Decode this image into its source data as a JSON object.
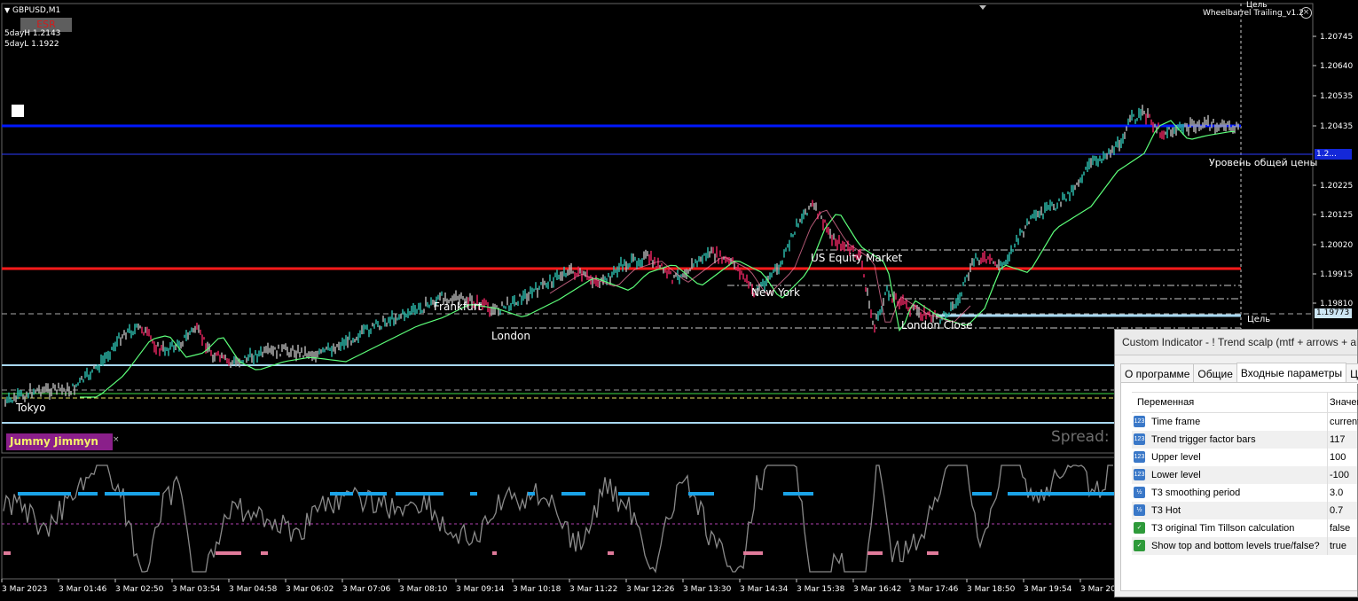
{
  "chart": {
    "symbol": "GBPUSD,M1",
    "esr_label": "ESR",
    "day_high": "5dayH 1.2143",
    "day_low": "5dayL 1.1922",
    "ea_name": "Wheelbarrel Trailing_v1.2",
    "target_top_label": "Цель",
    "target_label": "Цель",
    "avg_price_label": "Уровень общей цены",
    "avg_price_value": "1.2...",
    "target_price_value": "1.19773",
    "badge": "Jummy Jimmyn",
    "spread_label": "Spread:",
    "sessions": [
      "Tokyo",
      "Frankfurt",
      "London",
      "New York",
      "US Equity Market",
      "London Close"
    ],
    "price_axis": [
      "1.20745",
      "1.20640",
      "1.20535",
      "1.20435",
      "1.20225",
      "1.20125",
      "1.20020",
      "1.19915",
      "1.19810"
    ],
    "time_axis": [
      "3 Mar 2023",
      "3 Mar 01:46",
      "3 Mar 02:50",
      "3 Mar 03:54",
      "3 Mar 04:58",
      "3 Mar 06:02",
      "3 Mar 07:06",
      "3 Mar 08:10",
      "3 Mar 09:14",
      "3 Mar 10:18",
      "3 Mar 11:22",
      "3 Mar 12:26",
      "3 Mar 13:30",
      "3 Mar 14:34",
      "3 Mar 15:38",
      "3 Mar 16:42",
      "3 Mar 17:46",
      "3 Mar 18:50",
      "3 Mar 19:54",
      "3 Mar 20:"
    ],
    "colors": {
      "blue_line": "#0018ff",
      "red_line": "#ff1a1a",
      "light_blue": "#a8d8f0",
      "bull": "#2bb5a7",
      "bear": "#e0245e",
      "neutral": "#b0b0b0",
      "ma": "#5cff7a"
    }
  },
  "dialog": {
    "title": "Custom Indicator - ! Trend scalp (mtf + arrows + alerts + averages + mtf)",
    "tabs": [
      "О программе",
      "Общие",
      "Входные параметры",
      "Цвета"
    ],
    "active_tab": 2,
    "col_variable": "Переменная",
    "col_value": "Значение",
    "params": [
      {
        "icon": "123-icon",
        "name": "Time frame",
        "value": "current"
      },
      {
        "icon": "123-icon",
        "name": "Trend trigger factor bars",
        "value": "117"
      },
      {
        "icon": "123-icon",
        "name": "Upper level",
        "value": "100"
      },
      {
        "icon": "123-icon",
        "name": "Lower level",
        "value": "-100"
      },
      {
        "icon": "half-icon",
        "name": "T3 smoothing period",
        "value": "3.0"
      },
      {
        "icon": "half-icon",
        "name": "T3 Hot",
        "value": "0.7"
      },
      {
        "icon": "check-icon",
        "name": "T3 original Tim Tillson calculation",
        "value": "false"
      },
      {
        "icon": "check-icon",
        "name": "Show top and bottom levels true/false?",
        "value": "true"
      }
    ]
  }
}
